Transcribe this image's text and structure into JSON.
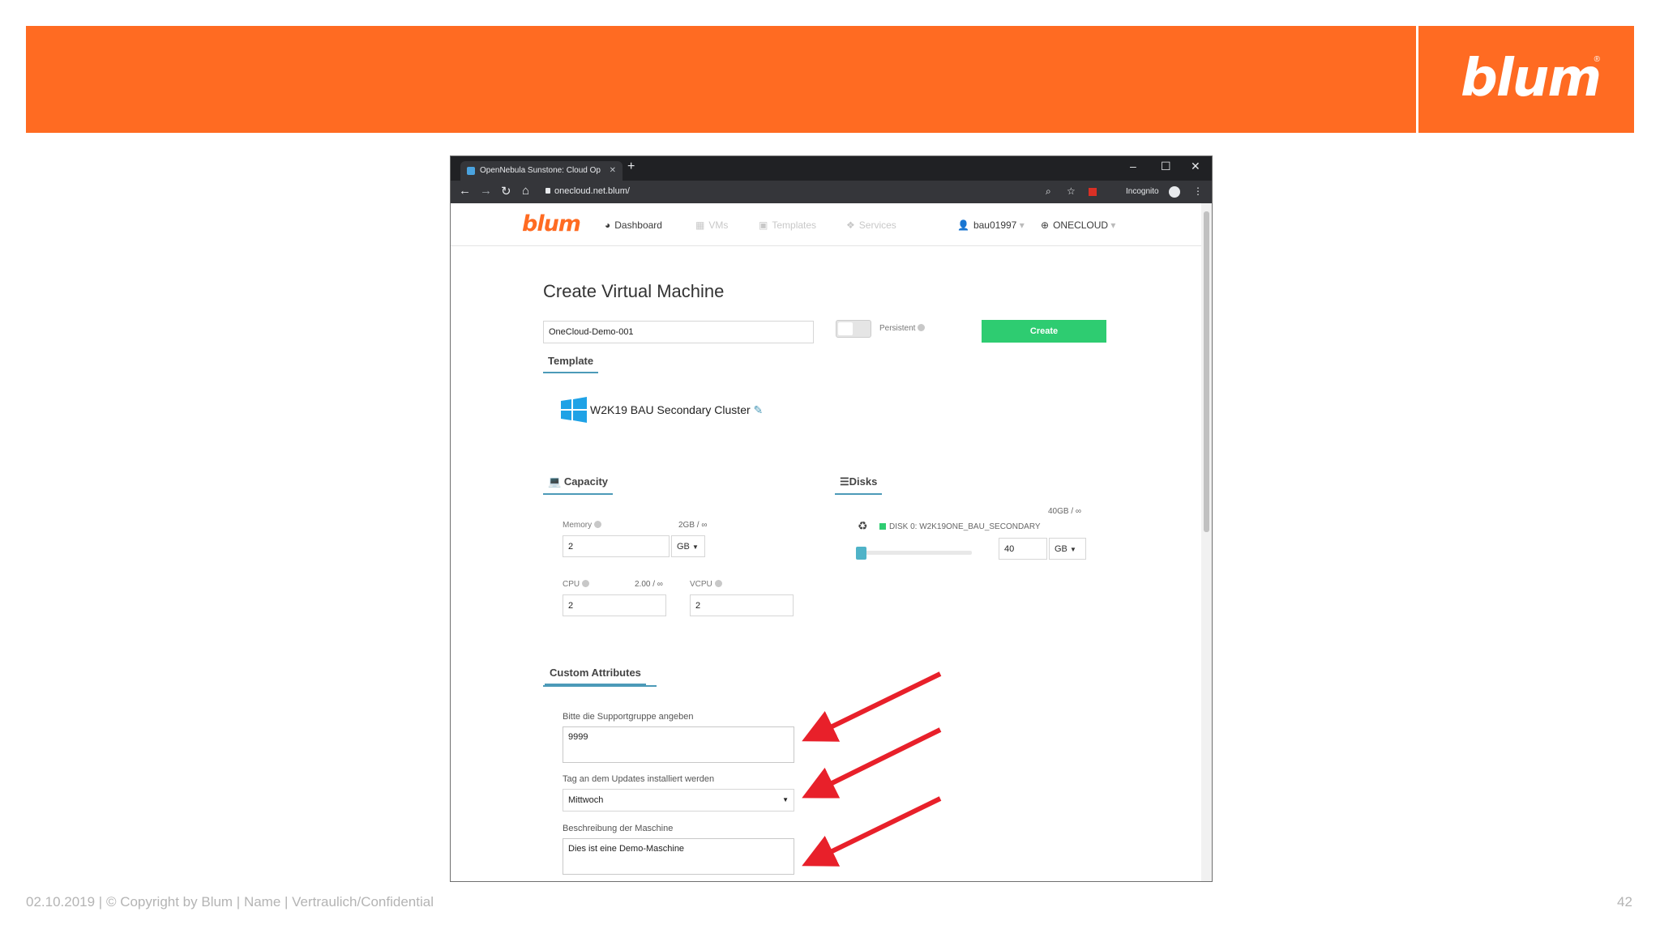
{
  "slide": {
    "logo": "blum",
    "footer": "02.10.2019 | © Copyright by Blum | Name | Vertraulich/Confidential",
    "page_number": "42"
  },
  "browser": {
    "tab_title": "OpenNebula Sunstone: Cloud Op",
    "url": "onecloud.net.blum/",
    "incognito_label": "Incognito"
  },
  "app": {
    "logo": "blum",
    "menu": {
      "dashboard": "Dashboard",
      "vms": "VMs",
      "templates": "Templates",
      "services": "Services",
      "user": "bau01997",
      "zone": "ONECLOUD"
    },
    "page_title": "Create Virtual Machine",
    "vm_name": "OneCloud-Demo-001",
    "persistent_label": "Persistent",
    "create_button": "Create",
    "template_tab": "Template",
    "template_name": "W2K19 BAU Secondary Cluster",
    "capacity_tab": "Capacity",
    "disks_tab": "Disks",
    "memory": {
      "label": "Memory",
      "limit": "2GB / ∞",
      "value": "2",
      "unit": "GB"
    },
    "cpu": {
      "label": "CPU",
      "limit": "2.00 / ∞",
      "value": "2"
    },
    "vcpu": {
      "label": "VCPU",
      "value": "2"
    },
    "disk": {
      "limit": "40GB / ∞",
      "name": "DISK 0: W2K19ONE_BAU_SECONDARY",
      "value": "40",
      "unit": "GB"
    },
    "custom_tab": "Custom Attributes",
    "support_label": "Bitte die Supportgruppe angeben",
    "support_value": "9999",
    "update_label": "Tag an dem Updates installiert werden",
    "update_value": "Mittwoch",
    "desc_label": "Beschreibung der Maschine",
    "desc_value": "Dies ist eine Demo-Maschine"
  },
  "colors": {
    "brand_orange": "#ff6b22",
    "create_green": "#2ecc71",
    "arrow_red": "#e8202a",
    "accent_blue": "#4c9ab8"
  }
}
